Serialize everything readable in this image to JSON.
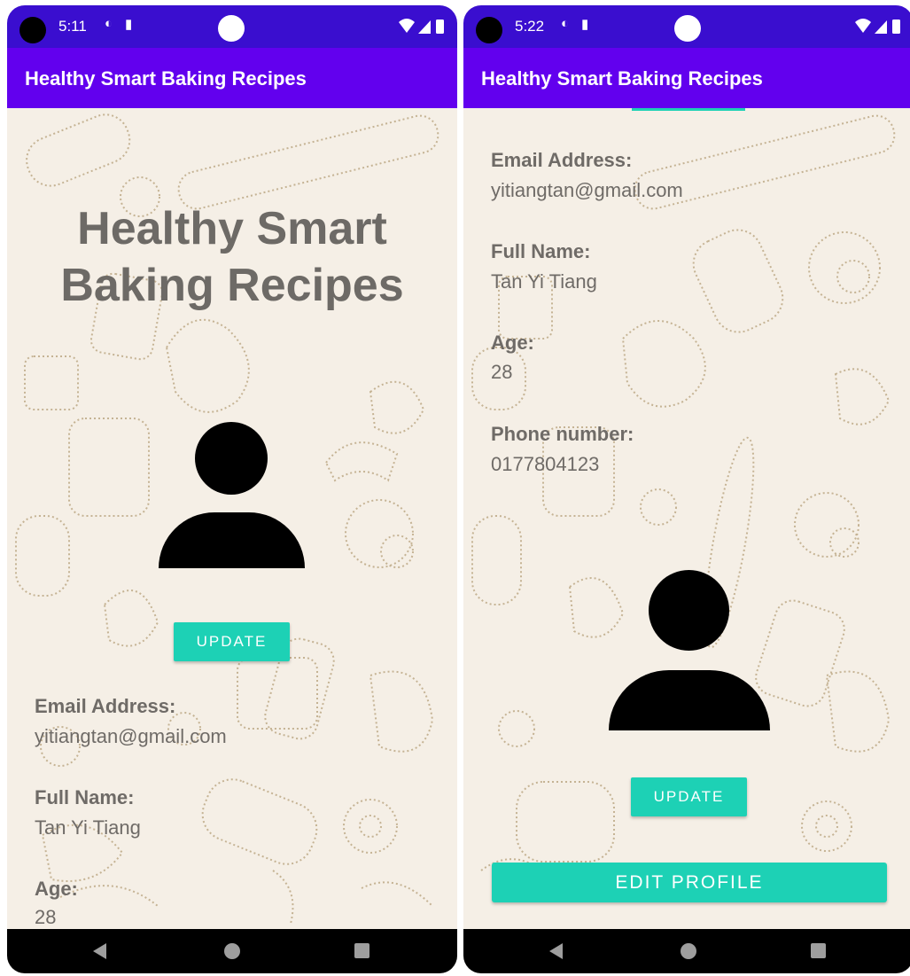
{
  "status_bar_left": {
    "time": "5:11",
    "icons": [
      "data-saver-icon",
      "sd-card-icon"
    ]
  },
  "status_bar_right": {
    "time": "5:22",
    "icons": [
      "data-saver-icon",
      "sd-card-icon"
    ]
  },
  "app_bar": {
    "title": "Healthy Smart Baking Recipes"
  },
  "hero": {
    "title_line1": "Healthy Smart",
    "title_line2": "Baking Recipes"
  },
  "buttons": {
    "update": "UPDATE",
    "edit_profile": "EDIT PROFILE"
  },
  "profile": {
    "email_label": "Email Address:",
    "email_value": "yitiangtan@gmail.com",
    "name_label": "Full Name:",
    "name_value": "Tan Yi Tiang",
    "age_label": "Age:",
    "age_value": "28",
    "phone_label": "Phone number:",
    "phone_value": "0177804123"
  },
  "colors": {
    "status_bar": "#3a0ecf",
    "app_bar": "#6200ee",
    "accent_button": "#1dd1b5",
    "background": "#f5efe6",
    "text": "#6f6b67"
  },
  "icons": [
    "avatar-icon",
    "wifi-icon",
    "signal-icon",
    "battery-icon",
    "back-icon",
    "home-icon",
    "recents-icon"
  ]
}
